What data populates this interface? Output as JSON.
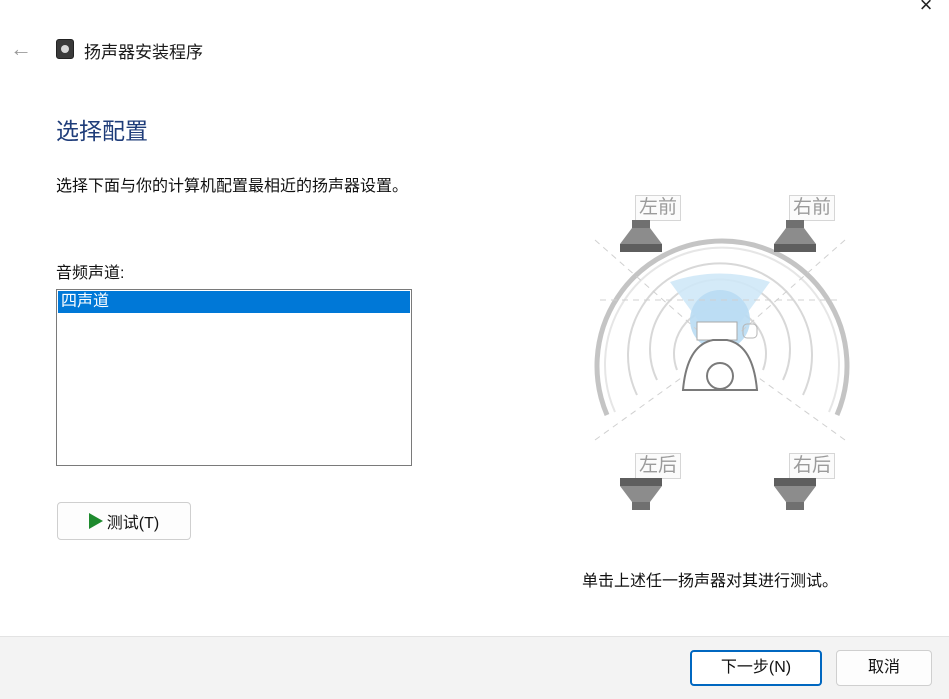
{
  "window": {
    "title": "扬声器安装程序",
    "close_glyph": "×"
  },
  "page": {
    "heading": "选择配置",
    "description": "选择下面与你的计算机配置最相近的扬声器设置。",
    "channel_label": "音频声道:",
    "channels": [
      {
        "label": "四声道",
        "selected": true
      }
    ],
    "test_button": "测试(T)"
  },
  "diagram": {
    "front_left": "左前",
    "front_right": "右前",
    "rear_left": "左后",
    "rear_right": "右后",
    "hint": "单击上述任一扬声器对其进行测试。"
  },
  "footer": {
    "next_button": "下一步(N)",
    "cancel_button": "取消"
  },
  "colors": {
    "accent": "#0078d7",
    "heading": "#1f3d7a",
    "play": "#1e8a2e"
  },
  "icons": [
    "back-arrow-icon",
    "speaker-app-icon",
    "close-icon",
    "play-icon",
    "speaker-icon"
  ]
}
